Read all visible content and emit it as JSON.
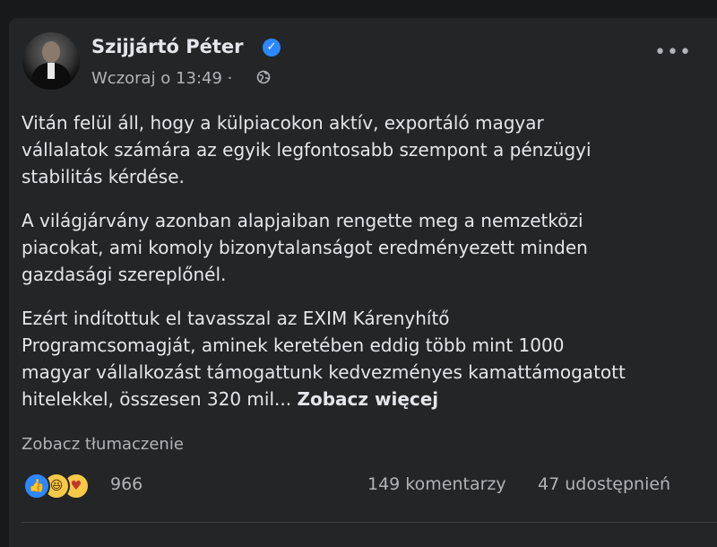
{
  "post": {
    "author": "Szijjártó Péter",
    "timestamp": "Wczoraj o 13:49",
    "meta_separator": "·",
    "privacy_icon": "globe-icon",
    "more_icon": "more-options-icon",
    "paragraphs": [
      [
        "Vitán felül áll, hogy a külpiacokon aktív, exportáló magyar",
        "vállalatok számára az egyik legfontosabb szempont a pénzügyi",
        "stabilitás kérdése."
      ],
      [
        "A világjárvány azonban alapjaiban rengette meg a nemzetközi",
        "piacokat, ami komoly bizonytalanságot eredményezett minden",
        "gazdasági szereplőnél."
      ],
      [
        "Ezért indítottuk el tavasszal az EXIM Kárenyhítő",
        "Programcsomagját, aminek keretében eddig több mint 1000",
        "magyar vállalkozást támogattunk kedvezményes kamattámogatott",
        "hitelekkel, összesen 320 mil..."
      ]
    ],
    "see_more": "Zobacz więcej",
    "translate": "Zobacz tłumaczenie"
  },
  "stats": {
    "reactions": [
      "like",
      "haha",
      "care"
    ],
    "reaction_count": "966",
    "comments": "149 komentarzy",
    "shares": "47 udostępnień"
  },
  "colors": {
    "background": "#18191a",
    "card": "#242526",
    "text_primary": "#e4e6eb",
    "text_secondary": "#b0b3b8",
    "accent": "#2d88ff"
  }
}
